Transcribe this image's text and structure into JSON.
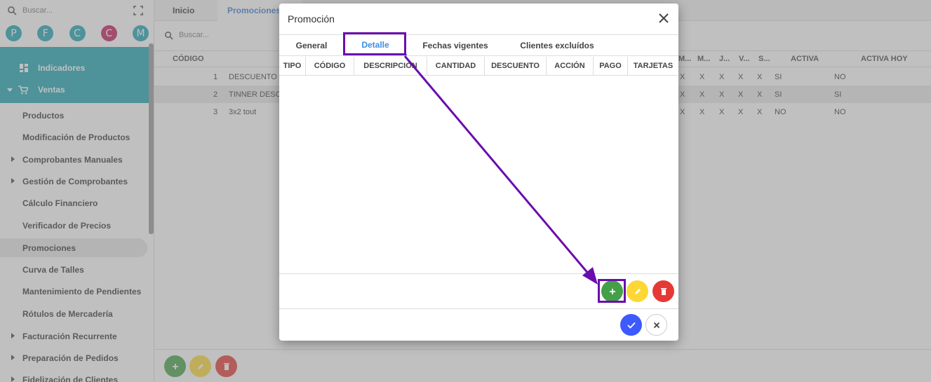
{
  "sidebar": {
    "search_placeholder": "Buscar...",
    "avatars": [
      {
        "letter": "P",
        "color": "#1ba3b3"
      },
      {
        "letter": "F",
        "color": "#1ba3b3"
      },
      {
        "letter": "C",
        "color": "#1ba3b3"
      },
      {
        "letter": "C",
        "color": "#c2185b"
      },
      {
        "letter": "M",
        "color": "#1ba3b3"
      }
    ],
    "indicadores": "Indicadores",
    "ventas": "Ventas",
    "items": [
      {
        "label": "Productos",
        "caret": false
      },
      {
        "label": "Modificación de Productos",
        "caret": false
      },
      {
        "label": "Comprobantes Manuales",
        "caret": true
      },
      {
        "label": "Gestión de Comprobantes",
        "caret": true
      },
      {
        "label": "Cálculo Financiero",
        "caret": false
      },
      {
        "label": "Verificador de Precios",
        "caret": false
      },
      {
        "label": "Promociones",
        "caret": false,
        "selected": true
      },
      {
        "label": "Curva de Talles",
        "caret": false
      },
      {
        "label": "Mantenimiento de Pendientes",
        "caret": false
      },
      {
        "label": "Rótulos de Mercadería",
        "caret": false
      },
      {
        "label": "Facturación Recurrente",
        "caret": true
      },
      {
        "label": "Preparación de Pedidos",
        "caret": true
      },
      {
        "label": "Fidelización de Clientes",
        "caret": true
      }
    ]
  },
  "top_tabs": {
    "inicio": "Inicio",
    "promociones": "Promociones"
  },
  "main": {
    "search_placeholder": "Buscar...",
    "headers": {
      "codigo": "CÓDIGO",
      "day_cols": [
        "M...",
        "M...",
        "J...",
        "V...",
        "S..."
      ],
      "activa": "ACTIVA",
      "activa_hoy": "ACTIVA HOY"
    },
    "rows": [
      {
        "codigo": "1",
        "descripcion": "DESCUENTO VI",
        "days": [
          "X",
          "X",
          "X",
          "X",
          "X"
        ],
        "activa": "SI",
        "activa_hoy": "NO"
      },
      {
        "codigo": "2",
        "descripcion": "TINNER DESCU",
        "days": [
          "X",
          "X",
          "X",
          "X",
          "X"
        ],
        "activa": "SI",
        "activa_hoy": "SI"
      },
      {
        "codigo": "3",
        "descripcion": "3x2 tout",
        "days": [
          "X",
          "X",
          "X",
          "X",
          "X"
        ],
        "activa": "NO",
        "activa_hoy": "NO"
      }
    ]
  },
  "dialog": {
    "title": "Promoción",
    "tabs": {
      "general": "General",
      "detalle": "Detalle",
      "fechas": "Fechas vigentes",
      "clientes": "Clientes excluídos"
    },
    "columns": {
      "tipo": "TIPO",
      "codigo": "CÓDIGO",
      "descripcion": "DESCRIPCIÓN",
      "cantidad": "CANTIDAD",
      "descuento": "DESCUENTO",
      "accion": "ACCIÓN",
      "pago": "PAGO",
      "tarjetas": "TARJETAS"
    }
  },
  "colors": {
    "teal": "#1ba3b3",
    "add_green": "#43a047",
    "edit_yellow": "#fdd835",
    "delete_red": "#e53935",
    "confirm_blue": "#3d5afe",
    "annotation_purple": "#6a0dad",
    "active_tab_blue": "#3a8ee6"
  }
}
